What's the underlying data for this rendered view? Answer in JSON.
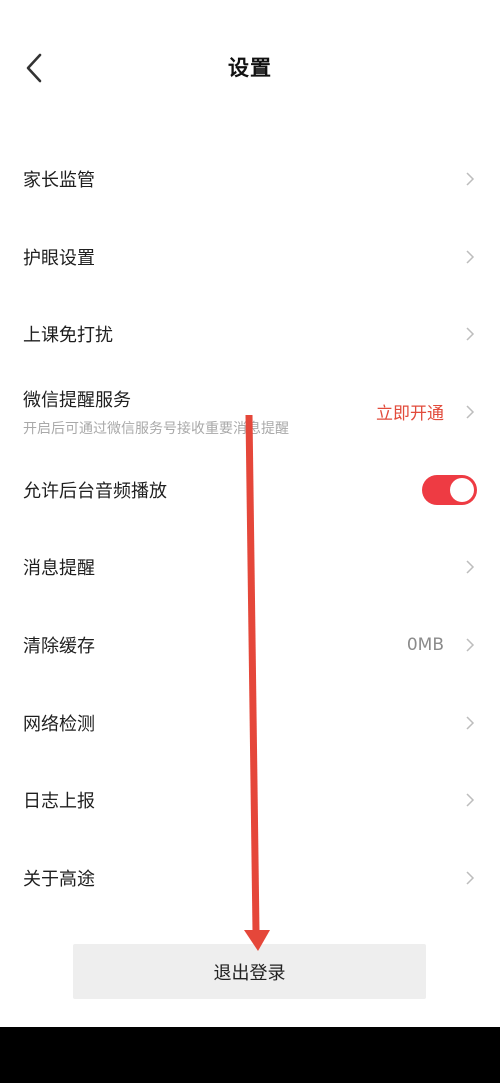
{
  "header": {
    "title": "设置",
    "back_icon": "chevron-left-icon"
  },
  "settings": {
    "items": [
      {
        "label": "家长监管",
        "type": "link"
      },
      {
        "label": "护眼设置",
        "type": "link"
      },
      {
        "label": "上课免打扰",
        "type": "link"
      },
      {
        "label": "微信提醒服务",
        "subtitle": "开启后可通过微信服务号接收重要消息提醒",
        "value": "立即开通",
        "type": "link"
      },
      {
        "label": "允许后台音频播放",
        "type": "toggle",
        "enabled": true
      },
      {
        "label": "消息提醒",
        "type": "link"
      },
      {
        "label": "清除缓存",
        "value": "0MB",
        "type": "link"
      },
      {
        "label": "网络检测",
        "type": "link"
      },
      {
        "label": "日志上报",
        "type": "link"
      },
      {
        "label": "关于高途",
        "type": "link"
      }
    ]
  },
  "logout": {
    "label": "退出登录"
  },
  "colors": {
    "accent": "#e24b3b",
    "toggle_on": "#ee3b43",
    "annotation_arrow": "#e5473a",
    "button_bg": "#eeeeee"
  },
  "annotation": {
    "type": "arrow",
    "direction": "down",
    "target": "logout-button"
  }
}
